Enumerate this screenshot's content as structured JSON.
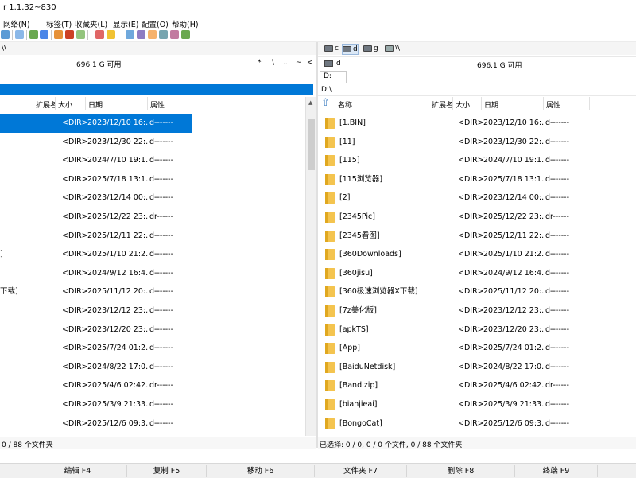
{
  "window": {
    "title": "r 1.1.32~830"
  },
  "menu": [
    "网络(N)",
    "标签(T)",
    "收藏夹(L)",
    "显示(E)",
    "配置(O)",
    "帮助(H)"
  ],
  "drives_right": [
    {
      "label": "c"
    },
    {
      "label": "d"
    },
    {
      "label": "g"
    },
    {
      "label": "\\\\"
    }
  ],
  "left_pane": {
    "path_marker": "\\\\",
    "free_space": "696.1 G 可用",
    "nav_symbols": [
      "*",
      "\\",
      "..",
      "~",
      "<"
    ],
    "columns": {
      "ext": "扩展名",
      "size": "大小",
      "date": "日期",
      "attr": "属性"
    },
    "rows": [
      {
        "name": "",
        "size": "<DIR>",
        "date": "2023/12/10 16:...",
        "attr": "d-------",
        "selected": true
      },
      {
        "name": "",
        "size": "<DIR>",
        "date": "2023/12/30 22:...",
        "attr": "d-------"
      },
      {
        "name": "",
        "size": "<DIR>",
        "date": "2024/7/10 19:1...",
        "attr": "d-------"
      },
      {
        "name": "",
        "size": "<DIR>",
        "date": "2025/7/18 13:1...",
        "attr": "d-------"
      },
      {
        "name": "",
        "size": "<DIR>",
        "date": "2023/12/14 00:...",
        "attr": "d-------"
      },
      {
        "name": "",
        "size": "<DIR>",
        "date": "2025/12/22 23:...",
        "attr": "dr------"
      },
      {
        "name": "",
        "size": "<DIR>",
        "date": "2025/12/11 22:...",
        "attr": "d-------"
      },
      {
        "name": "]",
        "size": "<DIR>",
        "date": "2025/1/10 21:2...",
        "attr": "d-------"
      },
      {
        "name": "",
        "size": "<DIR>",
        "date": "2024/9/12 16:4...",
        "attr": "d-------"
      },
      {
        "name": "下载]",
        "size": "<DIR>",
        "date": "2025/11/12 20:...",
        "attr": "d-------"
      },
      {
        "name": "",
        "size": "<DIR>",
        "date": "2023/12/12 23:...",
        "attr": "d-------"
      },
      {
        "name": "",
        "size": "<DIR>",
        "date": "2023/12/20 23:...",
        "attr": "d-------"
      },
      {
        "name": "",
        "size": "<DIR>",
        "date": "2025/7/24 01:2...",
        "attr": "d-------"
      },
      {
        "name": "",
        "size": "<DIR>",
        "date": "2024/8/22 17:0...",
        "attr": "d-------"
      },
      {
        "name": "",
        "size": "<DIR>",
        "date": "2025/4/6 02:42...",
        "attr": "dr------"
      },
      {
        "name": "",
        "size": "<DIR>",
        "date": "2025/3/9 21:33...",
        "attr": "d-------"
      },
      {
        "name": "",
        "size": "<DIR>",
        "date": "2025/12/6 09:3...",
        "attr": "d-------"
      }
    ],
    "status": "0 / 88 个文件夹"
  },
  "right_pane": {
    "drive_label": "d",
    "free_space": "696.1 G 可用",
    "tab_label": "D:",
    "path": "D:\\",
    "columns": {
      "name": "名称",
      "ext": "扩展名",
      "size": "大小",
      "date": "日期",
      "attr": "属性"
    },
    "rows": [
      {
        "name": "[1.BIN]",
        "size": "<DIR>",
        "date": "2023/12/10 16:...",
        "attr": "d-------"
      },
      {
        "name": "[11]",
        "size": "<DIR>",
        "date": "2023/12/30 22:...",
        "attr": "d-------"
      },
      {
        "name": "[115]",
        "size": "<DIR>",
        "date": "2024/7/10 19:1...",
        "attr": "d-------"
      },
      {
        "name": "[115浏览器]",
        "size": "<DIR>",
        "date": "2025/7/18 13:1...",
        "attr": "d-------"
      },
      {
        "name": "[2]",
        "size": "<DIR>",
        "date": "2023/12/14 00:...",
        "attr": "d-------"
      },
      {
        "name": "[2345Pic]",
        "size": "<DIR>",
        "date": "2025/12/22 23:...",
        "attr": "dr------"
      },
      {
        "name": "[2345看图]",
        "size": "<DIR>",
        "date": "2025/12/11 22:...",
        "attr": "d-------"
      },
      {
        "name": "[360Downloads]",
        "size": "<DIR>",
        "date": "2025/1/10 21:2...",
        "attr": "d-------"
      },
      {
        "name": "[360jisu]",
        "size": "<DIR>",
        "date": "2024/9/12 16:4...",
        "attr": "d-------"
      },
      {
        "name": "[360极速浏览器X下载]",
        "size": "<DIR>",
        "date": "2025/11/12 20:...",
        "attr": "d-------"
      },
      {
        "name": "[7z美化版]",
        "size": "<DIR>",
        "date": "2023/12/12 23:...",
        "attr": "d-------"
      },
      {
        "name": "[apkTS]",
        "size": "<DIR>",
        "date": "2023/12/20 23:...",
        "attr": "d-------"
      },
      {
        "name": "[App]",
        "size": "<DIR>",
        "date": "2025/7/24 01:2...",
        "attr": "d-------"
      },
      {
        "name": "[BaiduNetdisk]",
        "size": "<DIR>",
        "date": "2024/8/22 17:0...",
        "attr": "d-------"
      },
      {
        "name": "[Bandizip]",
        "size": "<DIR>",
        "date": "2025/4/6 02:42...",
        "attr": "dr------"
      },
      {
        "name": "[bianjieai]",
        "size": "<DIR>",
        "date": "2025/3/9 21:33...",
        "attr": "d-------"
      },
      {
        "name": "[BongoCat]",
        "size": "<DIR>",
        "date": "2025/12/6 09:3...",
        "attr": "d-------"
      }
    ],
    "status": "已选择: 0 / 0, 0 / 0 个文件, 0 / 88 个文件夹"
  },
  "function_keys": [
    {
      "label": "编辑 F4"
    },
    {
      "label": "复制 F5"
    },
    {
      "label": "移动 F6"
    },
    {
      "label": "文件夹 F7"
    },
    {
      "label": "删除 F8"
    },
    {
      "label": "终端 F9"
    }
  ],
  "colors": {
    "selection": "#0078d7",
    "folder": "#f4c44f",
    "path_highlight": "#0078d7"
  }
}
